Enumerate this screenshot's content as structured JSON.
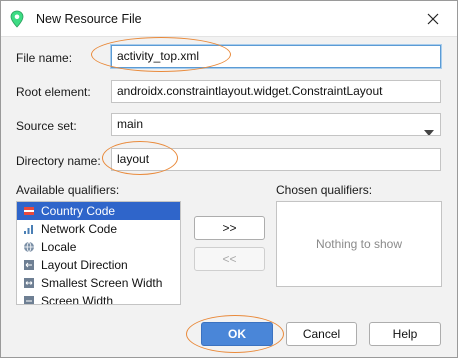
{
  "window": {
    "title": "New Resource File"
  },
  "form": {
    "file_name_label": "File name:",
    "file_name_value": "activity_top.xml",
    "root_element_label": "Root element:",
    "root_element_value": "androidx.constraintlayout.widget.ConstraintLayout",
    "source_set_label": "Source set:",
    "source_set_value": "main",
    "directory_name_label": "Directory name:",
    "directory_name_value": "layout"
  },
  "qualifiers": {
    "available_label": "Available qualifiers:",
    "chosen_label": "Chosen qualifiers:",
    "chosen_empty": "Nothing to show",
    "add_label": ">>",
    "remove_label": "<<",
    "items": [
      {
        "label": "Country Code",
        "icon": "flag-icon"
      },
      {
        "label": "Network Code",
        "icon": "network-icon"
      },
      {
        "label": "Locale",
        "icon": "globe-icon"
      },
      {
        "label": "Layout Direction",
        "icon": "layout-direction-icon"
      },
      {
        "label": "Smallest Screen Width",
        "icon": "screen-width-icon"
      },
      {
        "label": "Screen Width",
        "icon": "screen-width-icon"
      }
    ]
  },
  "buttons": {
    "ok": "OK",
    "cancel": "Cancel",
    "help": "Help"
  },
  "colors": {
    "accent": "#2f65ca",
    "highlight_ellipse": "#e98a3b",
    "primary_button": "#4a86d8"
  }
}
